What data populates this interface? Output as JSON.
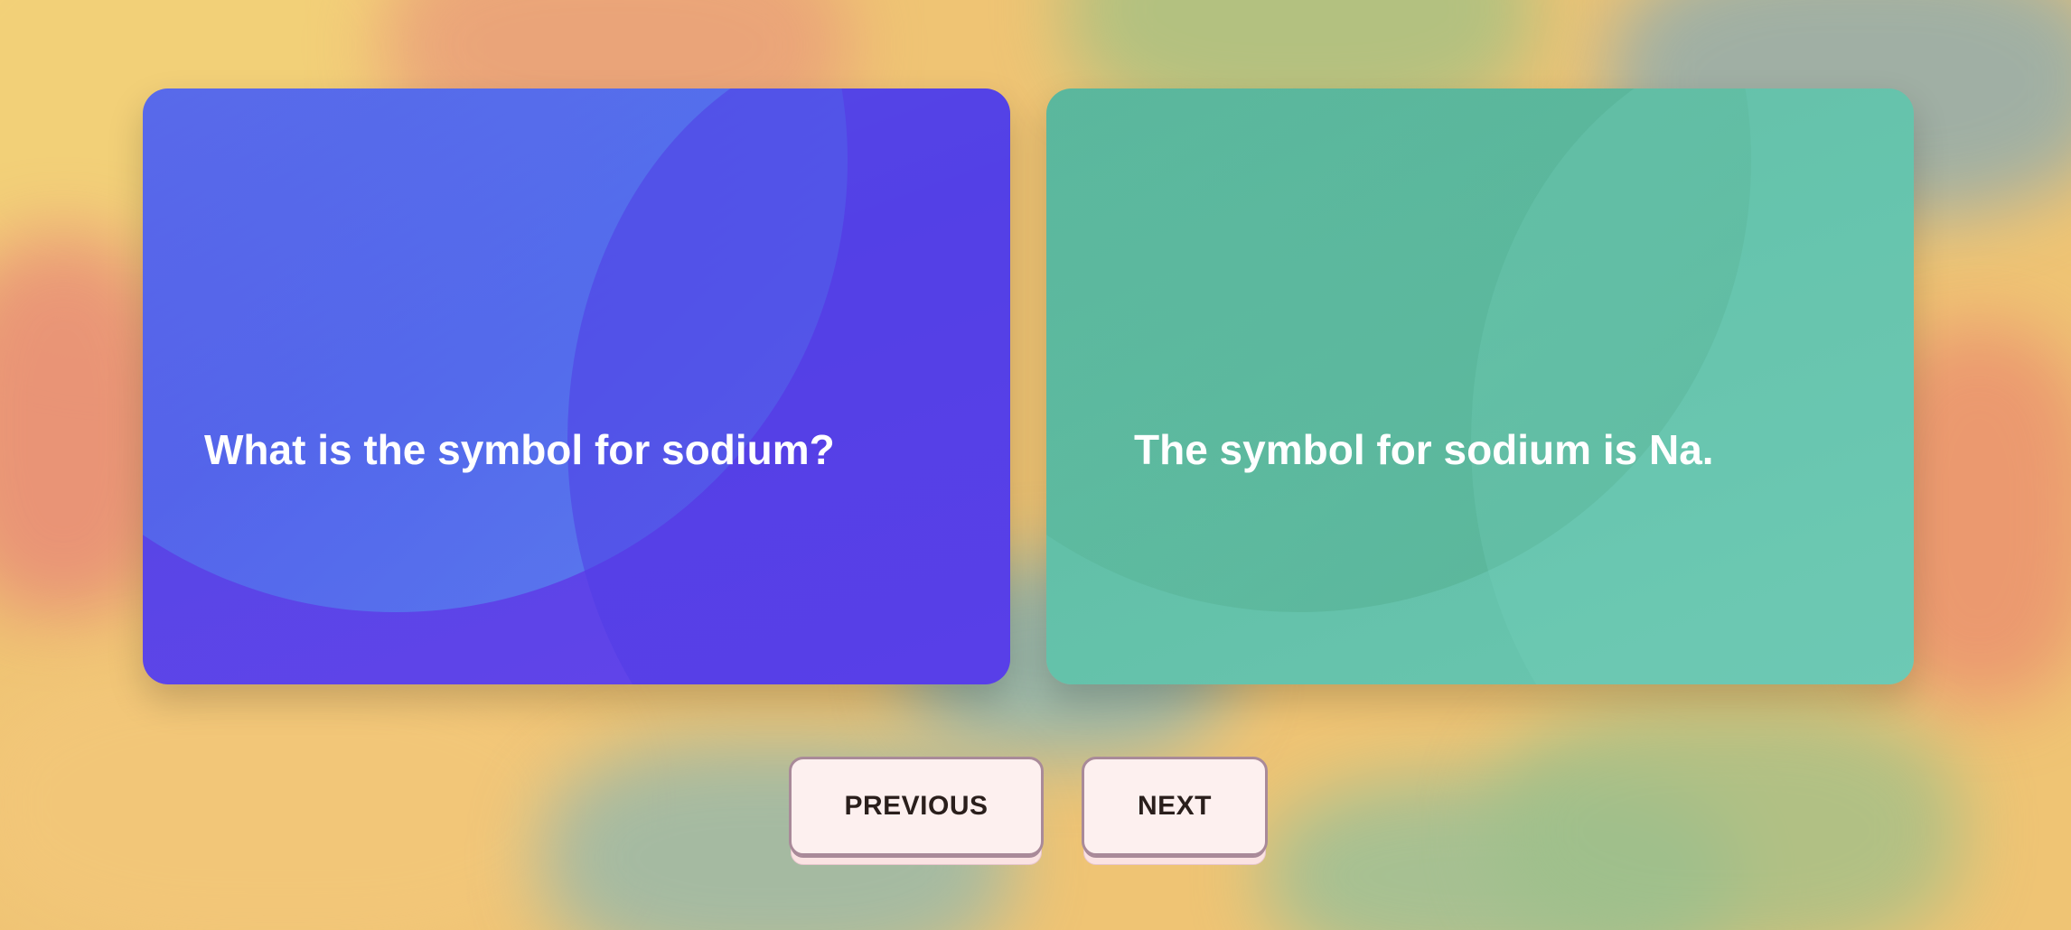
{
  "flashcard": {
    "question": "What is the symbol for sodium?",
    "answer": "The symbol for sodium is Na."
  },
  "controls": {
    "previous_label": "PREVIOUS",
    "next_label": "NEXT"
  },
  "colors": {
    "question_card": "#5845e6",
    "answer_card": "#62c0a8",
    "button_face": "#fdf0ef",
    "button_border": "#a98a99",
    "button_text": "#2a1f1c"
  }
}
